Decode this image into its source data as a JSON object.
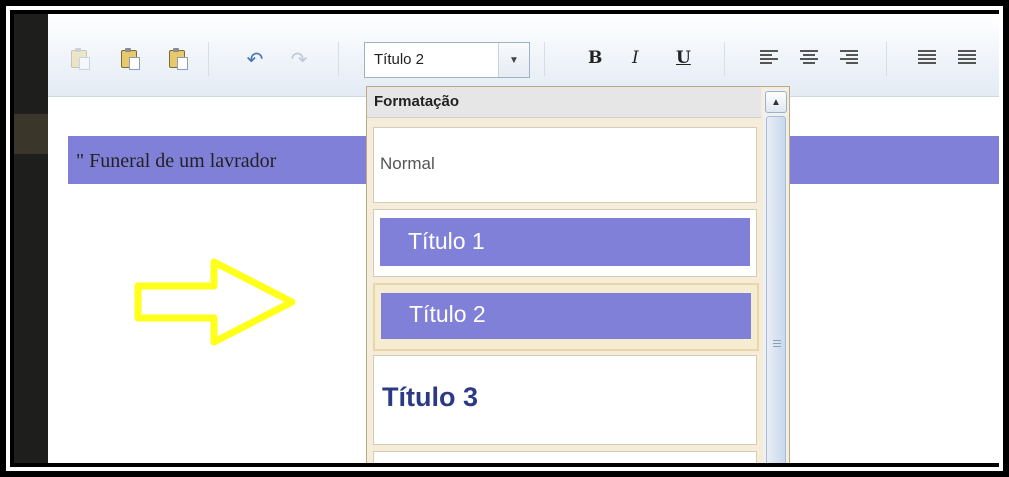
{
  "toolbar": {
    "icons": [
      "copy-icon",
      "paste-icon",
      "paste-text-icon",
      "undo-icon",
      "redo-icon"
    ],
    "format_select_value": "Título 2",
    "bold_label": "B",
    "italic_label": "I",
    "underline_label": "U"
  },
  "document": {
    "line_text": "\" Funeral de um lavrador",
    "highlight_color": "#8180d8"
  },
  "dropdown": {
    "header": "Formatação",
    "items": [
      {
        "label": "Normal",
        "style": "normal"
      },
      {
        "label": "Título 1",
        "style": "heading1"
      },
      {
        "label": "Título 2",
        "style": "heading2",
        "selected": true
      },
      {
        "label": "Título 3",
        "style": "heading3"
      }
    ]
  },
  "annotation": {
    "arrow_color": "#ffff1a"
  }
}
